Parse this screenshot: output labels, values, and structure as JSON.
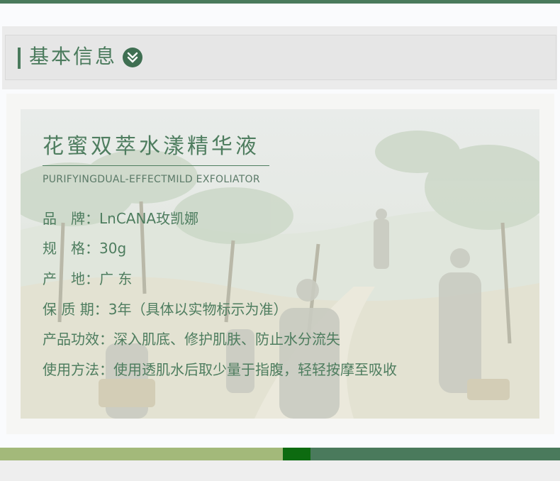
{
  "section": {
    "title": "基本信息",
    "icon": "chevron-down-icon"
  },
  "product": {
    "title": "花蜜双萃水漾精华液",
    "subtitle": "PURIFYINGDUAL-EFFECTMILD EXFOLIATOR"
  },
  "info": [
    {
      "label": "品　牌：",
      "value": "LnCANA玫凯娜"
    },
    {
      "label": "规　格：",
      "value": "30g"
    },
    {
      "label": "产　地：",
      "value": "广 东"
    },
    {
      "label": "保 质 期：",
      "value": "3年（具体以实物标示为准）"
    },
    {
      "label": "产品功效：",
      "value": "深入肌底、修护肌肤、防止水分流失"
    },
    {
      "label": "使用方法：",
      "value": "使用透肌水后取少量于指腹，轻轻按摩至吸收"
    }
  ],
  "colors": {
    "brand_green": "#4a7a5c",
    "strip_light": "#a3b97a",
    "strip_dark": "#0d6b10"
  }
}
